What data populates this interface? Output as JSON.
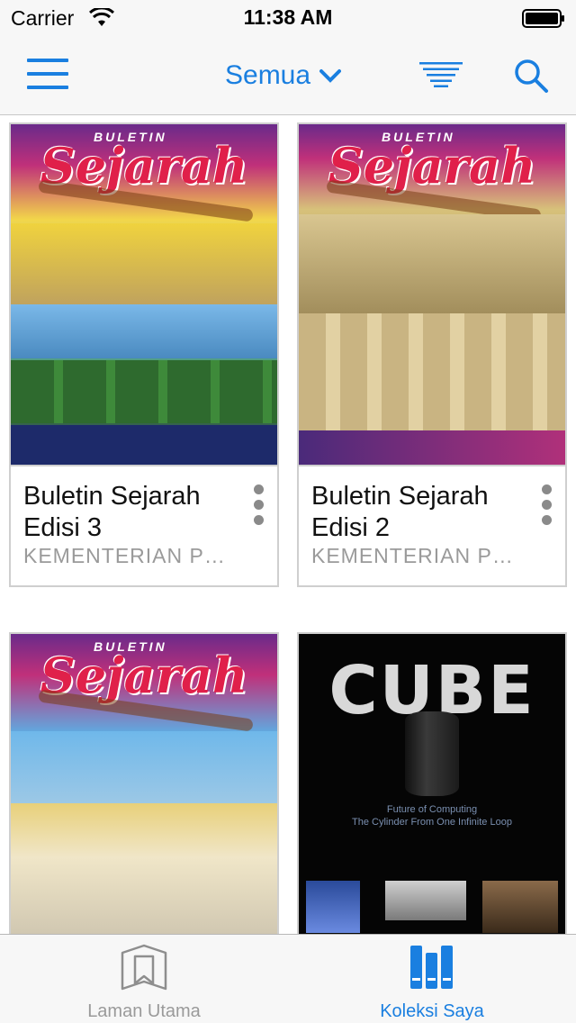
{
  "status_bar": {
    "carrier": "Carrier",
    "time": "11:38 AM"
  },
  "nav_bar": {
    "filter_label": "Semua",
    "menu_icon": "hamburger-menu-icon",
    "sort_icon": "sort-lines-icon",
    "search_icon": "search-icon",
    "accent_color": "#1a7fe0"
  },
  "cover_texts": {
    "buletin": "BULETIN",
    "sejarah": "Sejarah",
    "cube": "CUBE",
    "cube_caption_1": "Future of Computing",
    "cube_caption_2": "The Cylinder From One Infinite Loop"
  },
  "items": [
    {
      "title": "Buletin Sejarah Edisi 3",
      "publisher": "KEMENTERIAN PENDIDIKAN MALAYSIA"
    },
    {
      "title": "Buletin Sejarah Edisi 2",
      "publisher": "KEMENTERIAN PENDIDIKAN MALAYSIA"
    },
    {
      "title": "",
      "publisher": ""
    },
    {
      "title": "",
      "publisher": ""
    }
  ],
  "tabs": [
    {
      "label": "Laman Utama",
      "icon": "bookmark-book-icon",
      "active": false
    },
    {
      "label": "Koleksi Saya",
      "icon": "bookshelf-icon",
      "active": true
    }
  ]
}
